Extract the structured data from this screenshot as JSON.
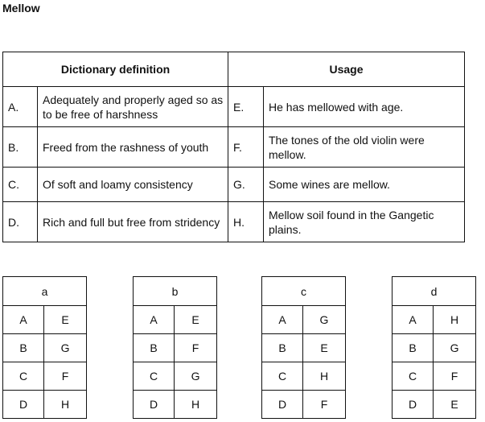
{
  "title": "Mellow",
  "main_table": {
    "headers": {
      "definition": "Dictionary definition",
      "usage": "Usage"
    },
    "rows": [
      {
        "def_letter": "A.",
        "def_text": "Adequately and properly aged so as to be free of harshness",
        "use_letter": "E.",
        "use_text": "He has mellowed with age."
      },
      {
        "def_letter": "B.",
        "def_text": "Freed from the rashness of youth",
        "use_letter": "F.",
        "use_text": "The tones of the old violin were mellow."
      },
      {
        "def_letter": "C.",
        "def_text": "Of soft and loamy consistency",
        "use_letter": "G.",
        "use_text": "Some wines are mellow."
      },
      {
        "def_letter": "D.",
        "def_text": "Rich and full but free from stridency",
        "use_letter": "H.",
        "use_text": "Mellow soil found in the Gangetic plains."
      }
    ]
  },
  "options": [
    {
      "label": "a",
      "pairs": [
        [
          "A",
          "E"
        ],
        [
          "B",
          "G"
        ],
        [
          "C",
          "F"
        ],
        [
          "D",
          "H"
        ]
      ]
    },
    {
      "label": "b",
      "pairs": [
        [
          "A",
          "E"
        ],
        [
          "B",
          "F"
        ],
        [
          "C",
          "G"
        ],
        [
          "D",
          "H"
        ]
      ]
    },
    {
      "label": "c",
      "pairs": [
        [
          "A",
          "G"
        ],
        [
          "B",
          "E"
        ],
        [
          "C",
          "H"
        ],
        [
          "D",
          "F"
        ]
      ]
    },
    {
      "label": "d",
      "pairs": [
        [
          "A",
          "H"
        ],
        [
          "B",
          "G"
        ],
        [
          "C",
          "F"
        ],
        [
          "D",
          "E"
        ]
      ]
    }
  ]
}
